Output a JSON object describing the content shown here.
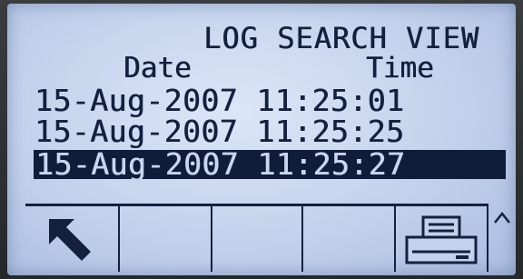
{
  "screen": {
    "title": "LOG SEARCH VIEW",
    "columns": {
      "date_label": "Date",
      "time_label": "Time"
    },
    "rows": [
      {
        "text": "15-Aug-2007 11:25:01",
        "selected": false
      },
      {
        "text": "15-Aug-2007 11:25:25",
        "selected": false
      },
      {
        "text": "15-Aug-2007 11:25:27",
        "selected": true
      }
    ]
  },
  "softkeys": [
    {
      "icon": "exit-arrow-icon"
    },
    {
      "icon": ""
    },
    {
      "icon": ""
    },
    {
      "icon": ""
    },
    {
      "icon": "printer-icon"
    }
  ],
  "scroll_indicator": {
    "icon": "scroll-up-icon"
  },
  "colors": {
    "lcd_background": "#c3d2ec",
    "lcd_text": "#13213f",
    "selection_background": "#0f1d3a"
  }
}
